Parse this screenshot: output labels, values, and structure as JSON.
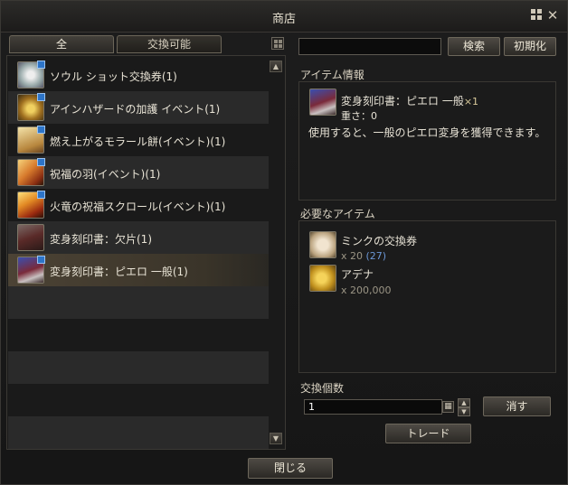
{
  "window": {
    "title": "商店"
  },
  "tabs": [
    {
      "label": "全",
      "active": true
    },
    {
      "label": "交換可能",
      "active": false
    }
  ],
  "items": [
    {
      "name": "ソウル ショット交換券(1)",
      "icon": "soulshot-ticket-icon"
    },
    {
      "name": "アインハザードの加護 イベント(1)",
      "icon": "golden-potion-icon"
    },
    {
      "name": "燃え上がるモラール餅(イベント)(1)",
      "icon": "exp-scroll-icon"
    },
    {
      "name": "祝福の羽(イベント)(1)",
      "icon": "feather-icon"
    },
    {
      "name": "火竜の祝福スクロール(イベント)(1)",
      "icon": "fire-scroll-icon"
    },
    {
      "name": "変身刻印書：欠片(1)",
      "icon": "book-fragment-icon"
    },
    {
      "name": "変身刻印書：ピエロ 一般(1)",
      "icon": "pierrot-book-icon",
      "selected": true
    }
  ],
  "search": {
    "value": "",
    "search_label": "検索",
    "reset_label": "初期化"
  },
  "item_info": {
    "heading": "アイテム情報",
    "name": "変身刻印書：ピエロ 一般",
    "count": "×1",
    "weight": "重さ：0",
    "description": "使用すると、一般のピエロ変身を獲得できます。"
  },
  "required": {
    "heading": "必要なアイテム",
    "items": [
      {
        "name": "ミンクの交換券",
        "qty": "x 20",
        "owned": "(27)",
        "icon": "mink-ticket-icon"
      },
      {
        "name": "アデナ",
        "qty": "x 200,000",
        "owned": "",
        "icon": "adena-coins-icon"
      }
    ]
  },
  "exchange": {
    "heading": "交換個数",
    "quantity": "1",
    "clear_label": "消す",
    "trade_label": "トレード"
  },
  "footer": {
    "close_label": "閉じる"
  },
  "colors": {
    "selected_row": "#4c4335",
    "accent_gold": "#d8b45a",
    "owned_blue": "#6b97d6"
  }
}
